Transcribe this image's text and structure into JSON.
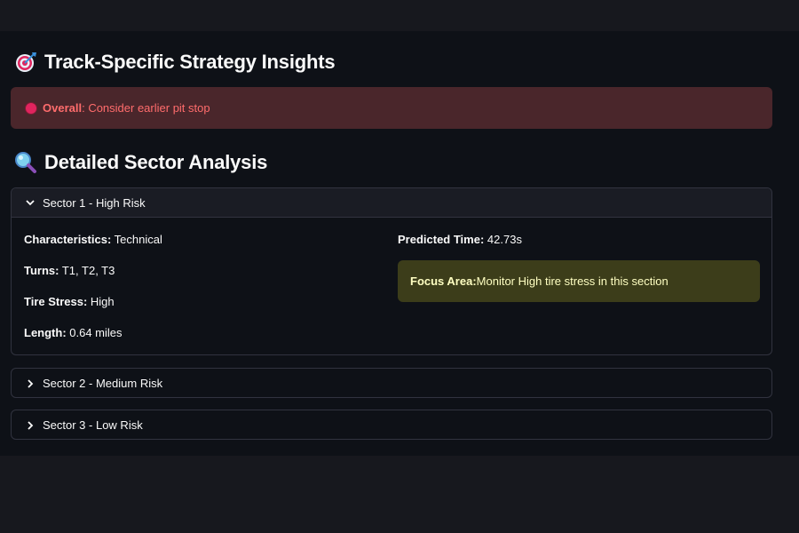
{
  "colors": {
    "background": "#0e1117",
    "error_bg": "#4a262b",
    "error_text": "#ff6c6c",
    "warning_bg": "#3c3d1a",
    "warning_text": "#ffffc2",
    "border": "#31333f"
  },
  "insights": {
    "icon": "dart-target-icon",
    "title": "Track-Specific Strategy Insights",
    "alert": {
      "icon": "red-circle-icon",
      "label": "Overall",
      "text": ": Consider earlier pit stop"
    }
  },
  "analysis": {
    "icon": "magnifying-glass-icon",
    "title": "Detailed Sector Analysis",
    "sectors": [
      {
        "header": "Sector 1 - High Risk",
        "expanded": true,
        "characteristics_label": "Characteristics:",
        "characteristics": " Technical",
        "turns_label": "Turns:",
        "turns": " T1, T2, T3",
        "tire_stress_label": "Tire Stress:",
        "tire_stress": " High",
        "length_label": "Length:",
        "length": " 0.64 miles",
        "predicted_label": "Predicted Time:",
        "predicted": " 42.73s",
        "focus_label": "Focus Area:",
        "focus": " Monitor High tire stress in this section"
      },
      {
        "header": "Sector 2 - Medium Risk",
        "expanded": false
      },
      {
        "header": "Sector 3 - Low Risk",
        "expanded": false
      }
    ]
  }
}
